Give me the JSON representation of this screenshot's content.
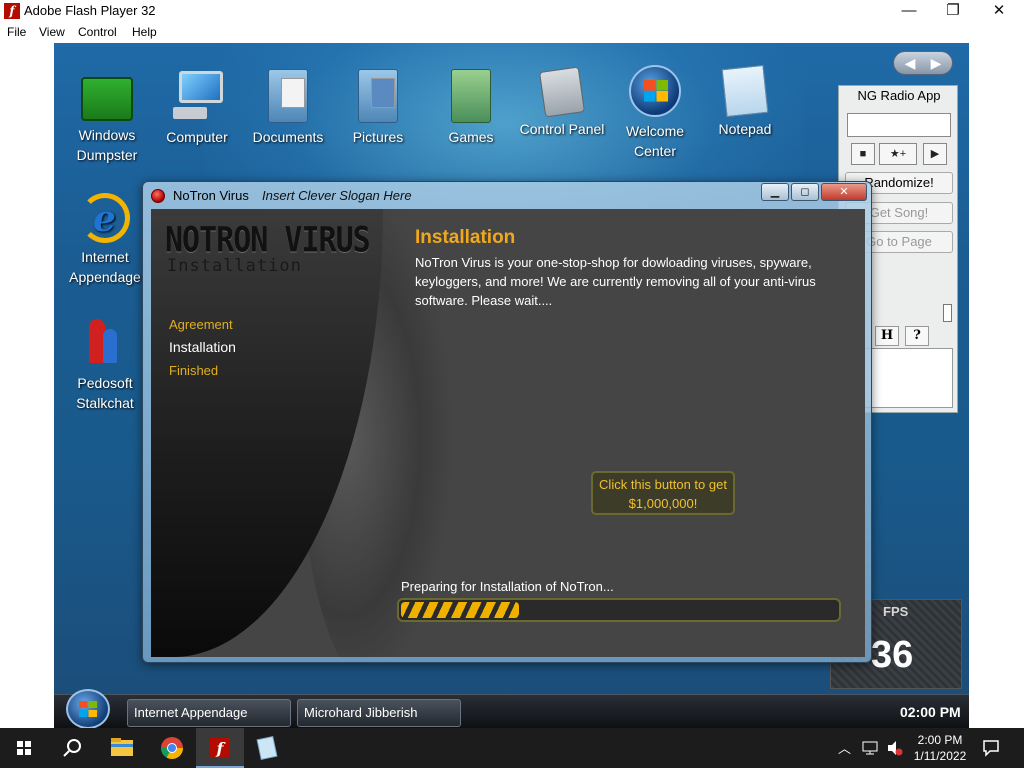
{
  "window": {
    "title": "Adobe Flash Player 32",
    "minimize": "—",
    "maximize": "❐",
    "close": "✕"
  },
  "menu": [
    "File",
    "View",
    "Control",
    "Help"
  ],
  "desktop_icons": [
    {
      "label": "Windows Dumpster",
      "icon": "dumpster-icon"
    },
    {
      "label": "Computer",
      "icon": "computer-icon"
    },
    {
      "label": "Documents",
      "icon": "documents-icon"
    },
    {
      "label": "Pictures",
      "icon": "pictures-icon"
    },
    {
      "label": "Games",
      "icon": "games-icon"
    },
    {
      "label": "Control Panel",
      "icon": "control-panel-icon"
    },
    {
      "label": "Welcome Center",
      "icon": "welcome-center-icon"
    },
    {
      "label": "Notepad",
      "icon": "notepad-icon"
    },
    {
      "label": "Internet Appendage",
      "icon": "internet-explorer-icon"
    },
    {
      "label": "Pedosoft Stalkchat",
      "icon": "messenger-icon"
    }
  ],
  "radio": {
    "title": "NG Radio App",
    "stop": "■",
    "favorite": "★+",
    "play": "▶",
    "randomize": "Randomize!",
    "get_song": "Get Song!",
    "go_to_page": "Go to Page",
    "tab_h": "H",
    "tab_help": "?"
  },
  "fps": {
    "label": "FPS",
    "value": "36"
  },
  "dialog": {
    "app_name": "NoTron Virus",
    "slogan": "Insert Clever Slogan Here",
    "logo": "NOTRON VIRUS",
    "logo_sub": "Installation",
    "steps": [
      {
        "label": "Agreement",
        "state": "done"
      },
      {
        "label": "Installation",
        "state": "active"
      },
      {
        "label": "Finished",
        "state": "done"
      }
    ],
    "heading": "Installation",
    "body": "NoTron Virus is your one-stop-shop for dowloading viruses, spyware, keyloggers, and more!  We are currently removing all of your anti-virus software.  Please wait....",
    "bait_button": "Click this button to get $1,000,000!",
    "progress_label": "Preparing for Installation of NoTron...",
    "progress": 0.27
  },
  "flash_taskbar": {
    "tasks": [
      "Internet Appendage",
      "Microhard Jibberish"
    ],
    "clock": "02:00 PM"
  },
  "os_taskbar": {
    "time": "2:00 PM",
    "date": "1/11/2022"
  },
  "colors": {
    "accent_orange": "#f0a81c",
    "step_gold": "#e0b020",
    "desktop_blue": "#1b5d93"
  }
}
